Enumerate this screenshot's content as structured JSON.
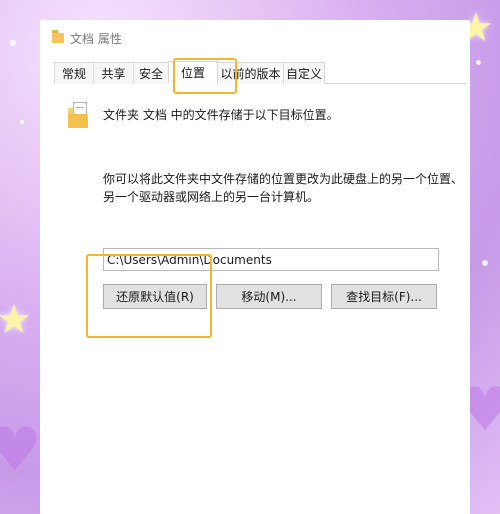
{
  "window": {
    "title": "文档 属性"
  },
  "tabs": [
    {
      "label": "常规",
      "active": false
    },
    {
      "label": "共享",
      "active": false
    },
    {
      "label": "安全",
      "active": false
    },
    {
      "label": "位置",
      "active": true
    },
    {
      "label": "以前的版本",
      "active": false
    },
    {
      "label": "自定义",
      "active": false
    }
  ],
  "location": {
    "info_text": "文件夹 文档 中的文件存储于以下目标位置。",
    "description": "你可以将此文件夹中文件存储的位置更改为此硬盘上的另一个位置、另一个驱动器或网络上的另一台计算机。",
    "path_value": "C:\\Users\\Admin\\Documents"
  },
  "buttons": {
    "restore_default": "还原默认值(R)",
    "move": "移动(M)...",
    "find_target": "查找目标(F)..."
  },
  "colors": {
    "highlight": "#f3b52a",
    "folder": "#f2c14e"
  }
}
